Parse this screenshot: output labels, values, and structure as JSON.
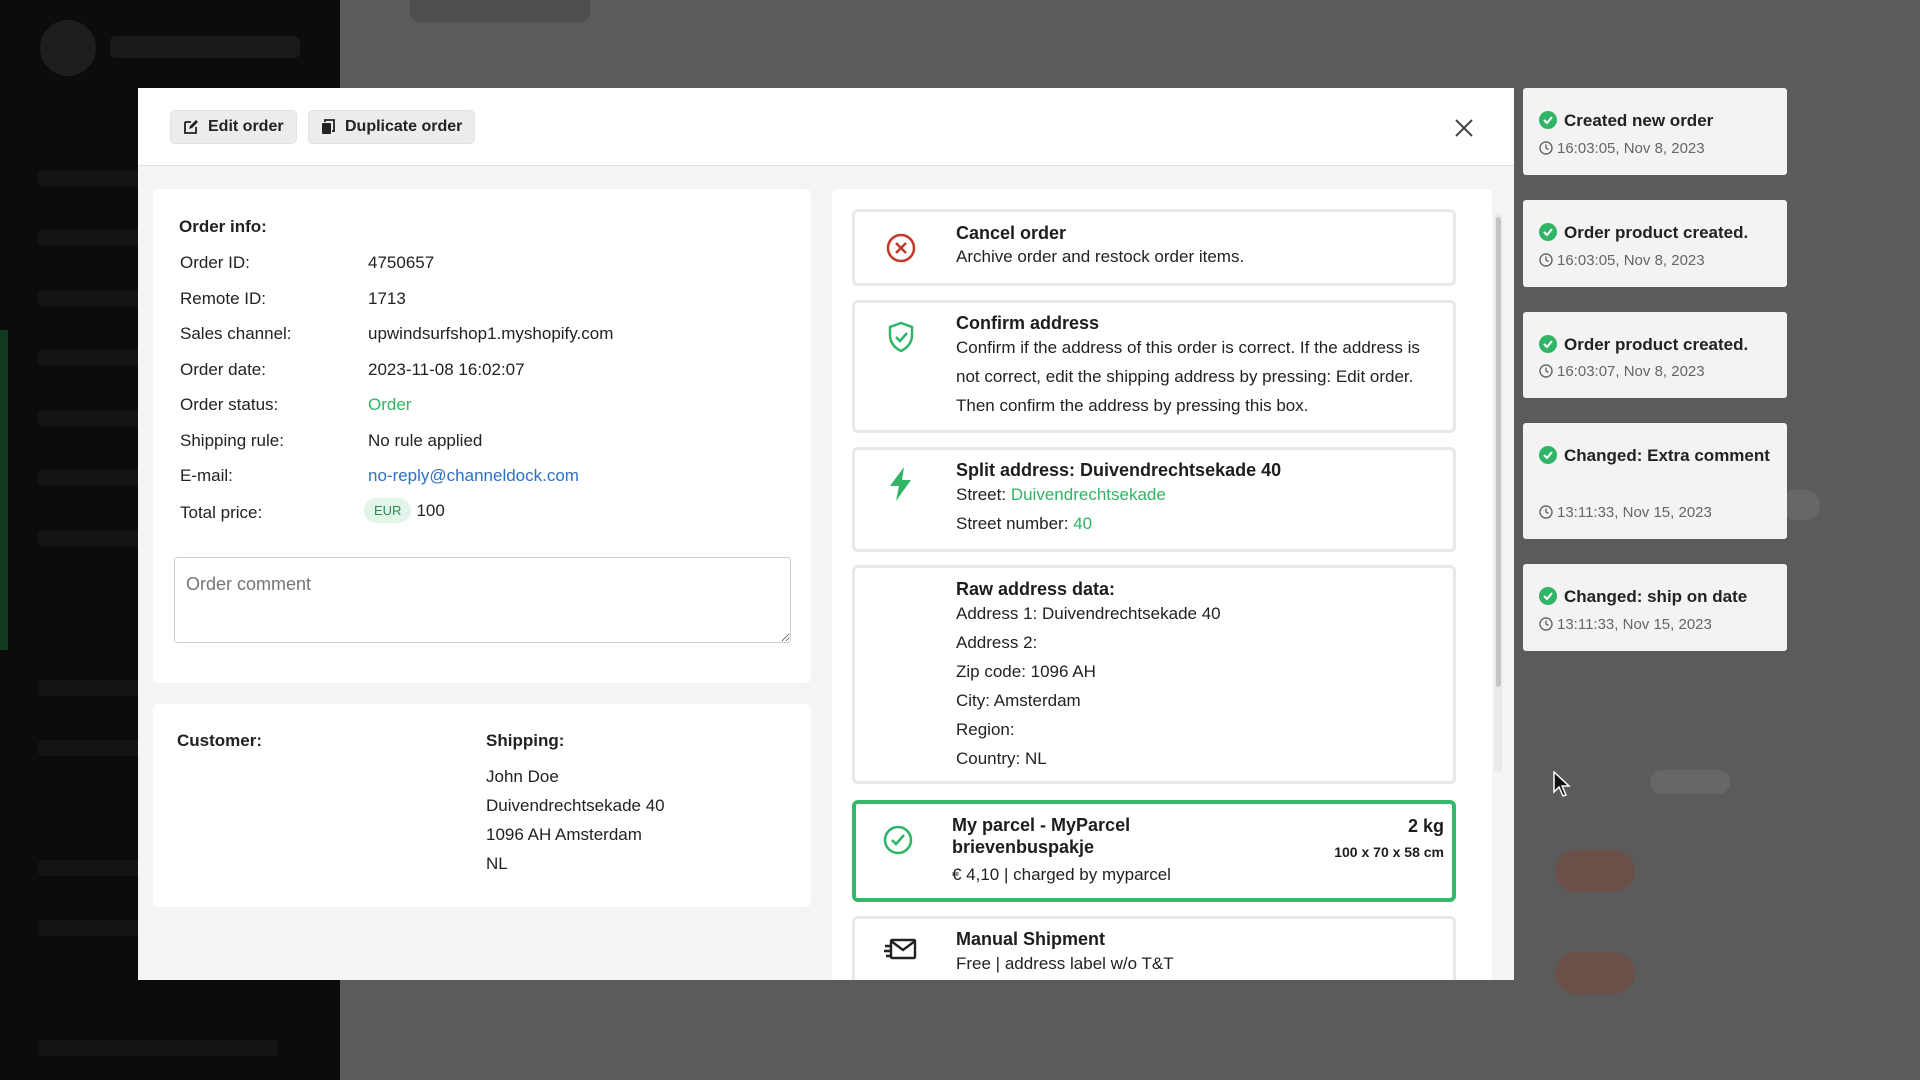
{
  "header": {
    "edit_label": "Edit order",
    "duplicate_label": "Duplicate order"
  },
  "order_info": {
    "title": "Order info:",
    "rows": [
      {
        "label": "Order ID:",
        "value": "4750657"
      },
      {
        "label": "Remote ID:",
        "value": "1713"
      },
      {
        "label": "Sales channel:",
        "value": "upwindsurfshop1.myshopify.com"
      },
      {
        "label": "Order date:",
        "value": "2023-11-08 16:02:07"
      },
      {
        "label": "Order status:",
        "value": "Order"
      },
      {
        "label": "Shipping rule:",
        "value": "No rule applied"
      },
      {
        "label": "E-mail:",
        "value": "no-reply@channeldock.com"
      }
    ],
    "total_label": "Total price:",
    "currency": "EUR",
    "total_value": "100",
    "comment_placeholder": "Order comment"
  },
  "customer": {
    "customer_title": "Customer:",
    "shipping_title": "Shipping:",
    "address_lines": [
      "John Doe",
      "Duivendrechtsekade 40",
      "1096 AH Amsterdam",
      "NL"
    ]
  },
  "actions": {
    "cancel": {
      "title": "Cancel order",
      "text": "Archive order and restock order items."
    },
    "confirm": {
      "title": "Confirm address",
      "text": "Confirm if the address of this order is correct. If the address is not correct, edit the shipping address by pressing: Edit order. Then confirm the address by pressing this box."
    },
    "split": {
      "title": "Split address: Duivendrechtsekade 40",
      "street_label": "Street:",
      "street_value": "Duivendrechtsekade",
      "number_label": "Street number:",
      "number_value": "40"
    },
    "raw": {
      "title": "Raw address data:",
      "lines": [
        "Address 1: Duivendrechtsekade 40",
        "Address 2:",
        "Zip code: 1096 AH",
        "City: Amsterdam",
        "Region:",
        "Country: NL"
      ]
    },
    "parcel": {
      "title": "My parcel - MyParcel brievenbuspakje",
      "weight": "2 kg",
      "dimensions": "100 x 70 x 58 cm",
      "price": "€ 4,10 | charged by myparcel"
    },
    "manual": {
      "title": "Manual Shipment",
      "text": "Free | address label w/o T&T"
    }
  },
  "activity_log": [
    {
      "title": "Created new order",
      "time": "16:03:05, Nov 8, 2023"
    },
    {
      "title": "Order product created.",
      "time": "16:03:05, Nov 8, 2023"
    },
    {
      "title": "Order product created.",
      "time": "16:03:07, Nov 8, 2023"
    },
    {
      "title": "Changed: Extra comment",
      "time": "13:11:33, Nov 15, 2023"
    },
    {
      "title": "Changed: ship on date",
      "time": "13:11:33, Nov 15, 2023"
    }
  ],
  "colors": {
    "accent_green": "#2fb565",
    "link_blue": "#2f6fc2",
    "danger_red": "#c0392b"
  }
}
